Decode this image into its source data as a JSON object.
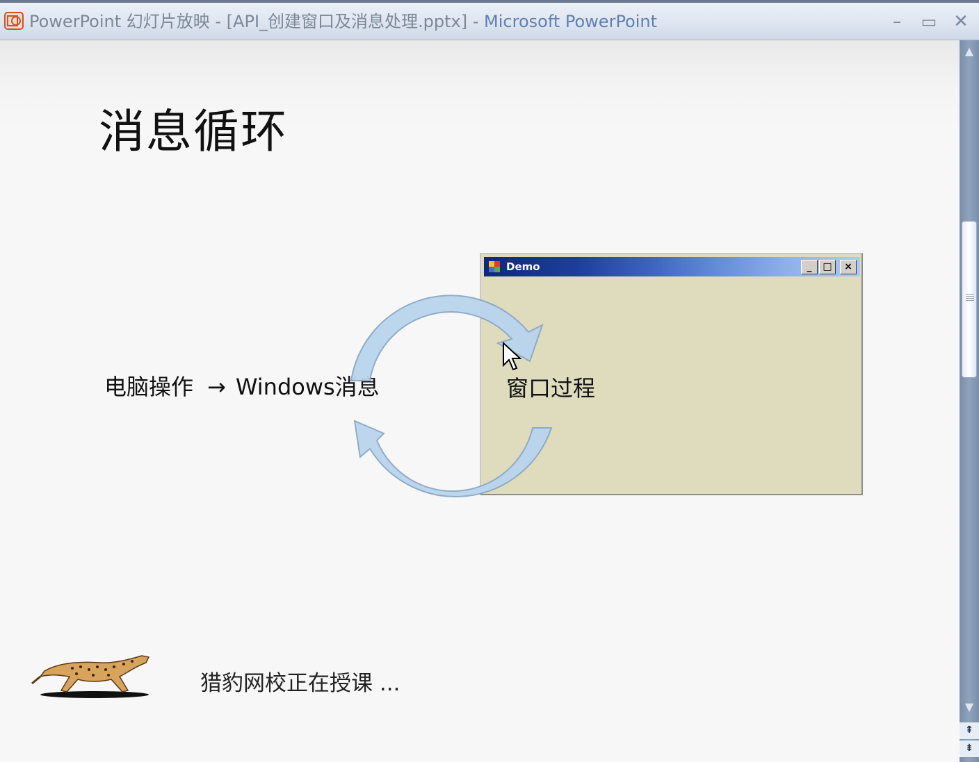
{
  "window": {
    "title_doc": "PowerPoint 幻灯片放映 - [API_创建窗口及消息处理.pptx] - ",
    "title_app": "Microsoft PowerPoint",
    "min_glyph": "–",
    "max_glyph": "▭",
    "close_glyph": "✕"
  },
  "slide": {
    "title": "消息循环",
    "flow_left": "电脑操作",
    "flow_arrow": "→",
    "flow_right": "Windows消息",
    "procedure_label": "窗口过程",
    "footer": "猎豹网校正在授课 ..."
  },
  "demo_window": {
    "title": "Demo",
    "min_glyph": "_",
    "max_glyph": "□",
    "close_glyph": "×"
  },
  "scrollbar": {
    "up_glyph": "▲",
    "down_glyph": "▼",
    "prev_glyph": "⇞",
    "next_glyph": "⇟"
  },
  "colors": {
    "demo_client": "#dfdcbe",
    "cycle_arrow_fill": "#b9d5ee",
    "cycle_arrow_stroke": "#8aa8c4",
    "title_app_text": "#5f7fb0"
  }
}
